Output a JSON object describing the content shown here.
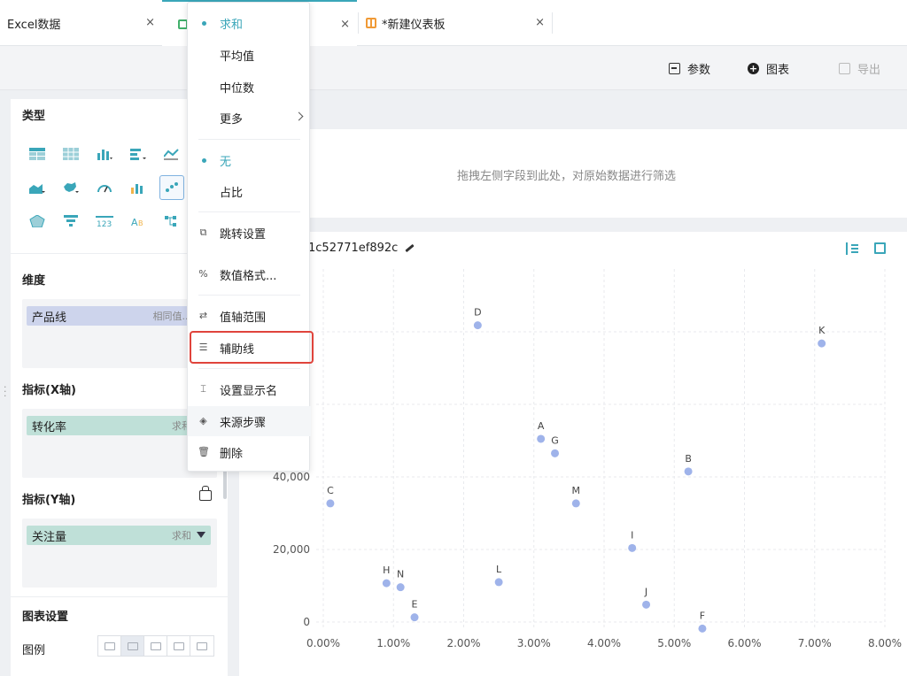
{
  "tabs": [
    {
      "label": "Excel数据",
      "close": "×"
    },
    {
      "label": "",
      "close": "×"
    },
    {
      "label": "*新建仪表板",
      "close": "×"
    }
  ],
  "toolbar": {
    "params_label": "参数",
    "chart_label": "图表",
    "export_label": "导出"
  },
  "left_panel": {
    "type_title": "类型",
    "dimension_title": "维度",
    "dimension_field": {
      "name": "产品线",
      "agg": "相同值..."
    },
    "x_metric_title": "指标(X轴)",
    "x_metric_field": {
      "name": "转化率",
      "agg": "求和"
    },
    "y_metric_title": "指标(Y轴)",
    "y_metric_field": {
      "name": "关注量",
      "agg": "求和"
    },
    "chart_settings_title": "图表设置",
    "legend_label": "图例"
  },
  "filter_area": {
    "hint": "拖拽左侧字段到此处，对原始数据进行筛选"
  },
  "chart": {
    "title": "1c52771ef892c"
  },
  "menu": {
    "items": [
      {
        "label": "求和",
        "active": true
      },
      {
        "label": "平均值"
      },
      {
        "label": "中位数"
      },
      {
        "label": "更多"
      },
      {
        "label": "无",
        "active": true
      },
      {
        "label": "占比"
      },
      {
        "label": "跳转设置"
      },
      {
        "label": "数值格式..."
      },
      {
        "label": "值轴范围"
      },
      {
        "label": "辅助线"
      },
      {
        "label": "设置显示名"
      },
      {
        "label": "来源步骤"
      },
      {
        "label": "删除"
      }
    ]
  },
  "colors": {
    "accent": "#3aa6b9",
    "point": "#9fb3ea",
    "highlight": "#e0443c"
  },
  "chart_data": {
    "type": "scatter",
    "title": "",
    "xlabel": "",
    "ylabel": "",
    "xlim": [
      0,
      0.08
    ],
    "x_ticks": [
      "0.00%",
      "1.00%",
      "2.00%",
      "3.00%",
      "4.00%",
      "5.00%",
      "6.00%",
      "7.00%",
      "8.00%"
    ],
    "y_ticks": [
      "0",
      "20,000",
      "40,000"
    ],
    "grid": true,
    "points": [
      {
        "label": "A",
        "x": 0.031,
        "y": 50500
      },
      {
        "label": "B",
        "x": 0.052,
        "y": 41500
      },
      {
        "label": "C",
        "x": 0.001,
        "y": 32700
      },
      {
        "label": "D",
        "x": 0.022,
        "y": 81800
      },
      {
        "label": "E",
        "x": 0.013,
        "y": 1300
      },
      {
        "label": "F",
        "x": 0.054,
        "y": -1800
      },
      {
        "label": "G",
        "x": 0.033,
        "y": 46500
      },
      {
        "label": "H",
        "x": 0.009,
        "y": 10700
      },
      {
        "label": "I",
        "x": 0.044,
        "y": 20400
      },
      {
        "label": "J",
        "x": 0.046,
        "y": 4800
      },
      {
        "label": "K",
        "x": 0.071,
        "y": 76800
      },
      {
        "label": "L",
        "x": 0.025,
        "y": 11000
      },
      {
        "label": "M",
        "x": 0.036,
        "y": 32700
      },
      {
        "label": "N",
        "x": 0.011,
        "y": 9600
      }
    ]
  }
}
